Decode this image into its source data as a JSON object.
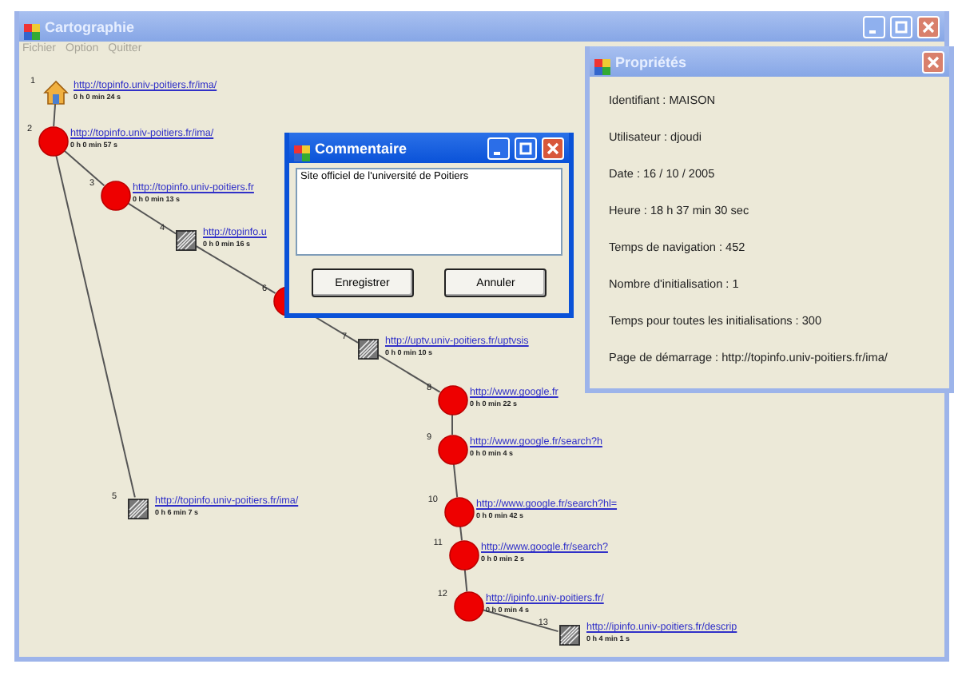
{
  "window": {
    "title": "Cartographie",
    "active": false
  },
  "menu": [
    {
      "label": "Fichier",
      "disabled": true
    },
    {
      "label": "Option",
      "disabled": true
    },
    {
      "label": "Quitter",
      "disabled": true
    }
  ],
  "map": {
    "nodes": [
      {
        "number": "1",
        "kind": "home",
        "url": "http://topinfo.univ-poitiers.fr/ima/",
        "time": "0 h 0 min 24 s",
        "children": [
          {
            "number": "2",
            "kind": "page",
            "url": "http://topinfo.univ-poitiers.fr/ima/",
            "time": "0 h 0 min 57 s",
            "children": [
              {
                "number": "3",
                "kind": "page",
                "url": "http://topinfo.univ-poitiers.fr",
                "time": "0 h 0 min 13 s",
                "children": [
                  {
                    "number": "4",
                    "kind": "image",
                    "url": "http://topinfo.u",
                    "time": "0 h 0 min 16 s",
                    "children": [
                      {
                        "number": "6",
                        "kind": "page",
                        "children": [
                          {
                            "number": "7",
                            "kind": "image",
                            "url": "http://uptv.univ-poitiers.fr/uptvsis",
                            "time": "0 h 0 min 10 s",
                            "children": [
                              {
                                "number": "8",
                                "kind": "page",
                                "url": "http://www.google.fr",
                                "time": "0 h 0 min 22 s",
                                "children": [
                                  {
                                    "number": "9",
                                    "kind": "page",
                                    "url": "http://www.google.fr/search?h",
                                    "time": "0 h 0 min 4 s",
                                    "children": [
                                      {
                                        "number": "10",
                                        "kind": "page",
                                        "url": "http://www.google.fr/search?hl=",
                                        "time": "0 h 0 min 42 s",
                                        "children": [
                                          {
                                            "number": "11",
                                            "kind": "page",
                                            "url": "http://www.google.fr/search?",
                                            "time": "0 h 0 min 2 s",
                                            "children": [
                                              {
                                                "number": "12",
                                                "kind": "page",
                                                "url": "http://ipinfo.univ-poitiers.fr/",
                                                "time": "0 h 0 min 4 s",
                                                "children": [
                                                  {
                                                    "number": "13",
                                                    "kind": "image",
                                                    "url": "http://ipinfo.univ-poitiers.fr/descrip",
                                                    "time": "0 h 4 min 1 s"
                                                  }
                                                ]
                                              }
                                            ]
                                          }
                                        ]
                                      }
                                    ]
                                  }
                                ]
                              }
                            ]
                          }
                        ]
                      }
                    ]
                  }
                ]
              },
              {
                "number": "5",
                "kind": "image",
                "url": "http://topinfo.univ-poitiers.fr/ima/",
                "time": "0 h 6 min 7 s"
              }
            ]
          }
        ]
      }
    ]
  },
  "comment_dialog": {
    "title": "Commentaire",
    "active": true,
    "text": "Site officiel de l'université de Poitiers",
    "buttons": [
      "Enregistrer",
      "Annuler"
    ]
  },
  "properties": {
    "title": "Propriétés",
    "active": false,
    "lines": [
      "Identifiant : MAISON",
      "Utilisateur : djoudi",
      "Date : 16 / 10 / 2005",
      "Heure : 18 h 37 min 30 sec",
      "Temps de navigation :  452",
      "Nombre d'initialisation :  1",
      "Temps pour toutes les initialisations :  300",
      "Page de démarrage :  http://topinfo.univ-poitiers.fr/ima/"
    ]
  }
}
